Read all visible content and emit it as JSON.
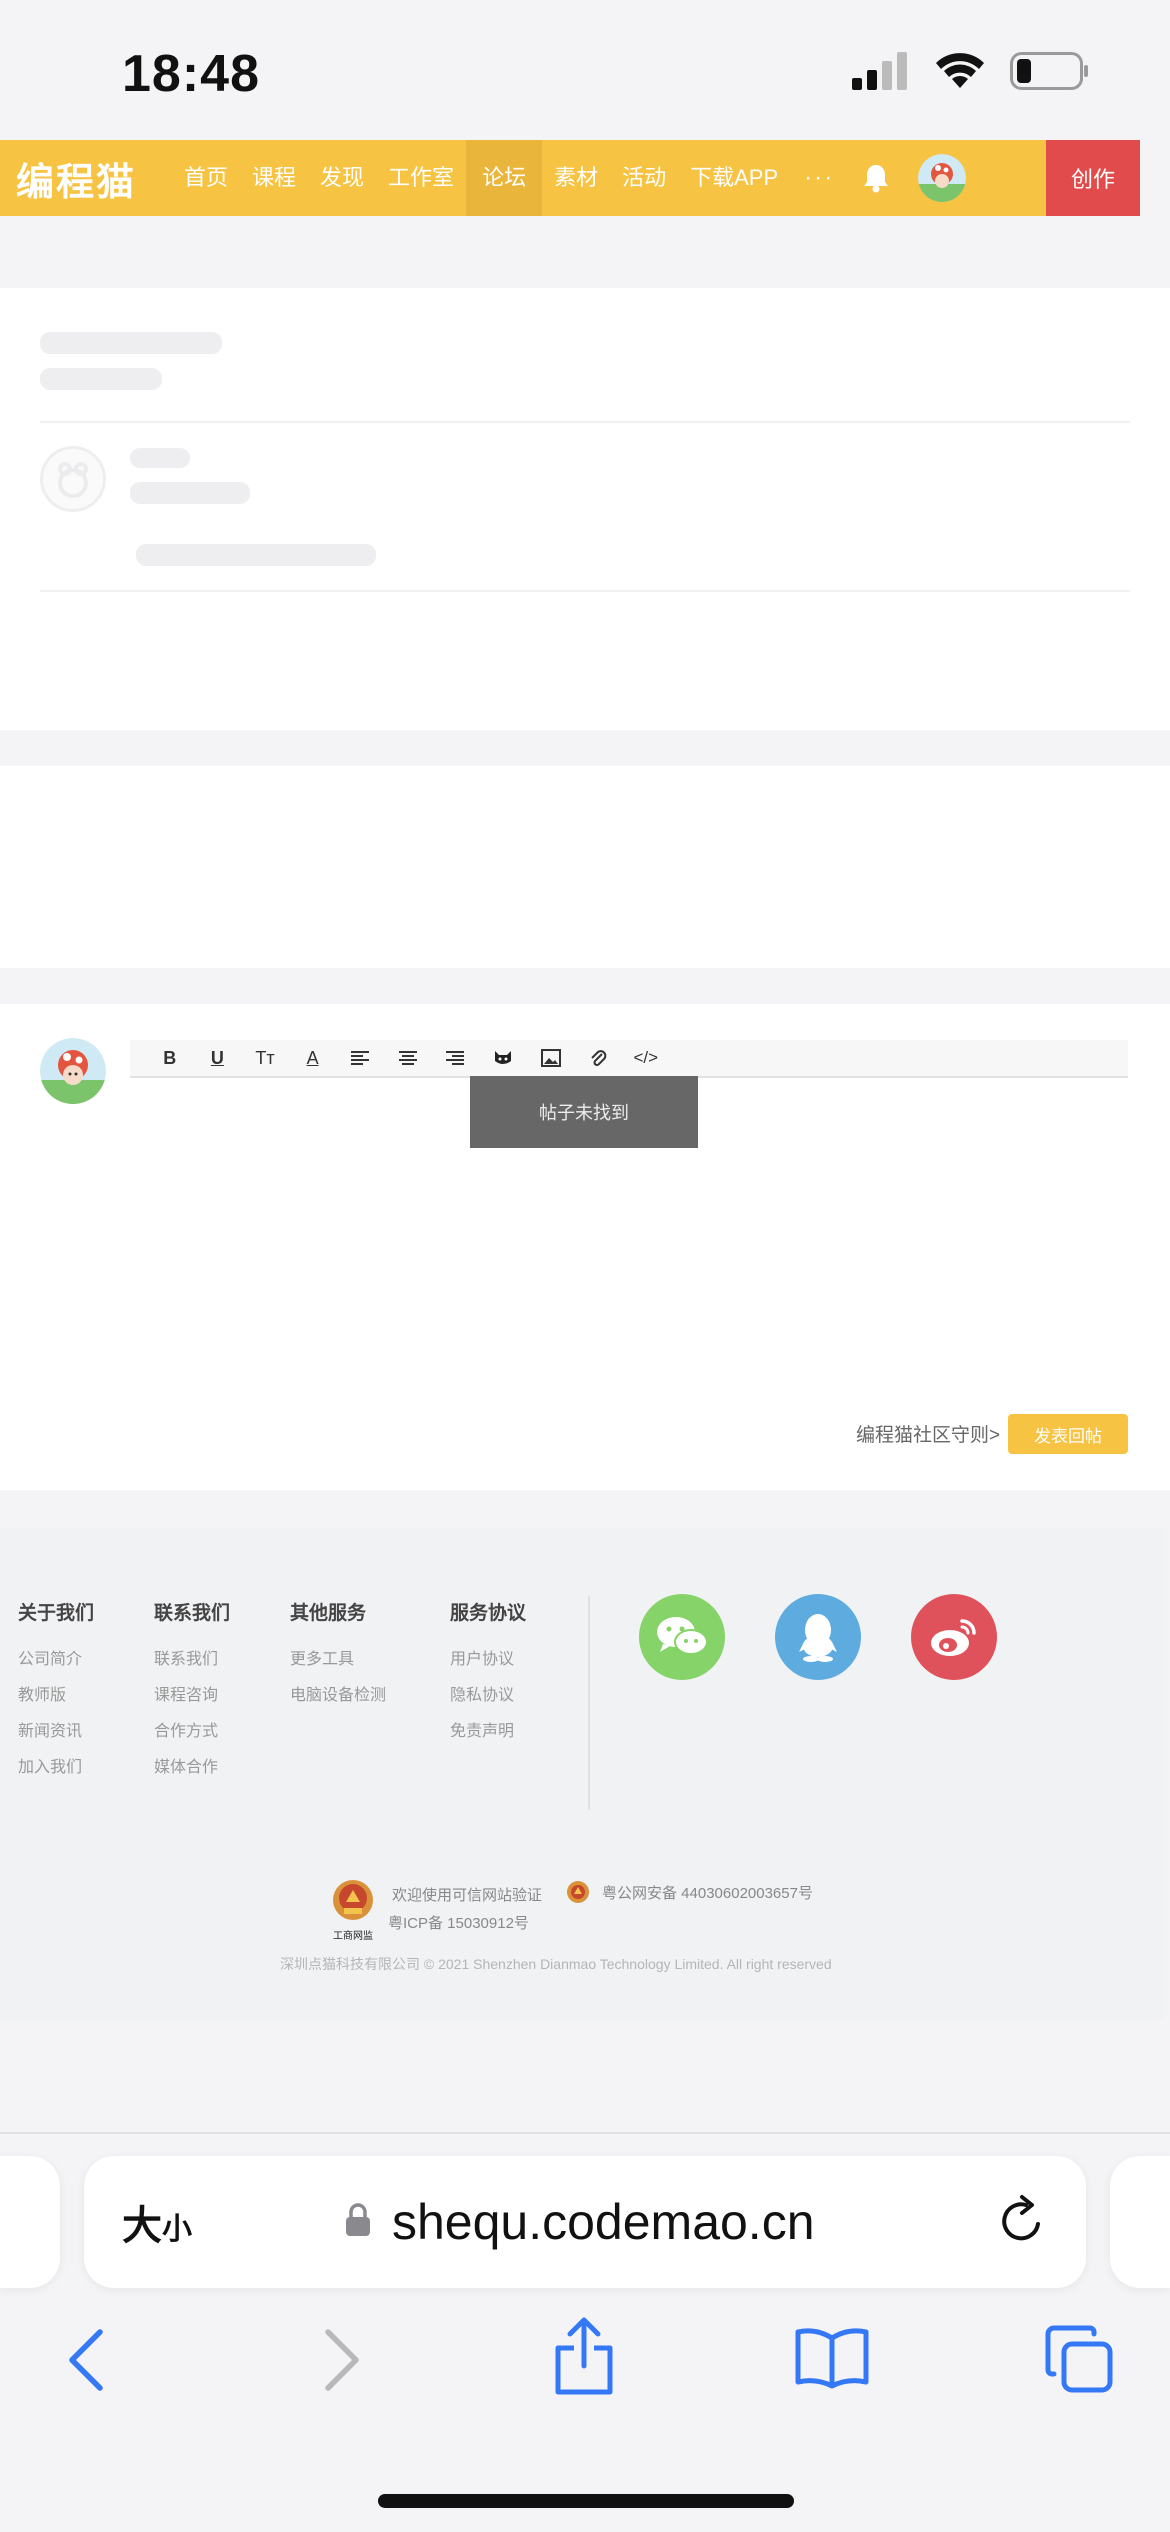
{
  "status_bar": {
    "time": "18:48"
  },
  "nav": {
    "logo": "编程猫",
    "items": [
      "首页",
      "课程",
      "发现",
      "工作室",
      "论坛",
      "素材",
      "活动",
      "下载APP"
    ],
    "active": "论坛",
    "more": "···",
    "create_label": "创作"
  },
  "editor": {
    "toolbar_labels": {
      "bold": "B",
      "underline": "U",
      "text_size": "Tт",
      "font_color": "A",
      "code": "</>"
    },
    "toast": "帖子未找到",
    "guide_link": "编程猫社区守则>",
    "submit_label": "发表回帖"
  },
  "footer": {
    "columns": [
      {
        "title": "关于我们",
        "links": [
          "公司简介",
          "教师版",
          "新闻资讯",
          "加入我们"
        ]
      },
      {
        "title": "联系我们",
        "links": [
          "联系我们",
          "课程咨询",
          "合作方式",
          "媒体合作"
        ]
      },
      {
        "title": "其他服务",
        "links": [
          "更多工具",
          "电脑设备检测"
        ]
      },
      {
        "title": "服务协议",
        "links": [
          "用户协议",
          "隐私协议",
          "免责声明"
        ]
      }
    ],
    "trust_badge": "工商网监",
    "verify_text": "欢迎使用可信网站验证",
    "police_text": "粤公网安备 44030602003657号",
    "icp": "粤ICP备 15030912号",
    "copyright": "深圳点猫科技有限公司   © 2021 Shenzhen Dianmao Technology Limited. All right reserved"
  },
  "browser": {
    "text_size_label_big": "大",
    "text_size_label_small": "小",
    "url": "shequ.codemao.cn"
  },
  "colors": {
    "brand_yellow": "#f6c343",
    "create_red": "#e24b4b",
    "wechat": "#86d36a",
    "qq": "#5eabe0",
    "weibo": "#e0525b",
    "ios_blue": "#3478f6"
  }
}
